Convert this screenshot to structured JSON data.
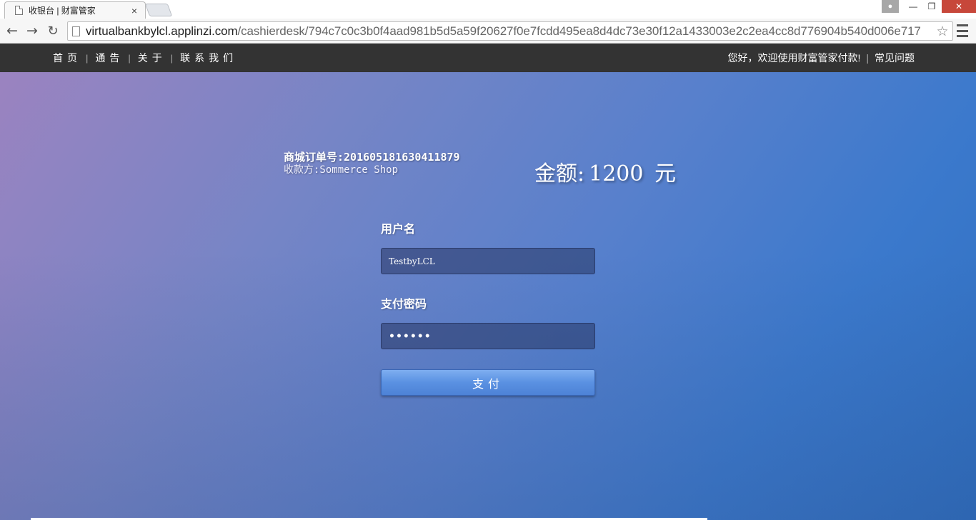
{
  "browser": {
    "tab_title": "收银台 | 财富管家",
    "tab_close": "×",
    "url_host": "virtualbankbylcl.applinzi.com",
    "url_path": "/cashierdesk/794c7c0c3b0f4aad981b5d5a59f20627f0e7fcdd495ea8d4dc73e30f12a1433003e2c2ea4cc8d776904b540d006e717"
  },
  "site_nav": {
    "left_links": [
      "首页",
      "通告",
      "关于",
      "联系我们"
    ],
    "welcome": "您好，欢迎使用财富管家付款!",
    "faq": "常见问题"
  },
  "order": {
    "order_no": "商城订单号:201605181630411879",
    "payee": "收款方:Sommerce Shop",
    "amount_label": "金额:",
    "amount_value": "1200",
    "amount_unit": "元"
  },
  "form": {
    "username_label": "用户名",
    "username_value": "TestbyLCL",
    "password_label": "支付密码",
    "password_value": "••••••",
    "pay_button": "支付"
  }
}
